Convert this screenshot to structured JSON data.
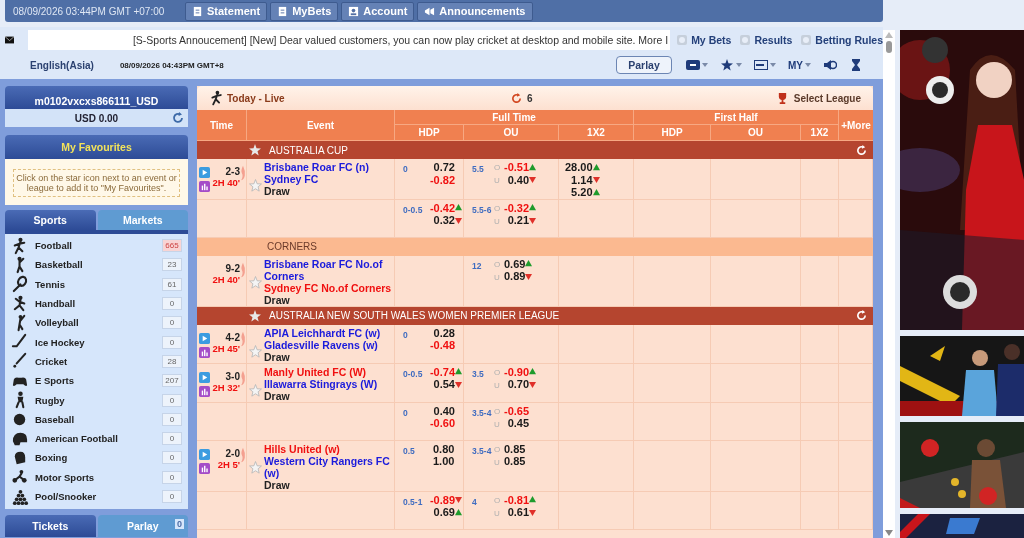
{
  "top_bar": {
    "datetime": "08/09/2026 03:44PM GMT +07:00",
    "buttons": [
      {
        "label": "Statement"
      },
      {
        "label": "MyBets"
      },
      {
        "label": "Account"
      },
      {
        "label": "Announcements"
      }
    ]
  },
  "announcement": "[S-Sports Annoucement] [New] Dear valued customers, you can now play cricket at desktop and mobile site. More I",
  "links": [
    "My Bets",
    "Results",
    "Betting Rules"
  ],
  "language": "English(Asia)",
  "local_time": "08/09/2026 04:43PM GMT+8",
  "parlay_button": "Parlay",
  "odds_format": "MY",
  "account": {
    "username": "m0102vxcxs866111_USD",
    "balance": "USD 0.00"
  },
  "favourites": {
    "title": "My Favourites",
    "hint": "Click on the star icon next to an event or league to add it to \"My Favourites\"."
  },
  "sidebar_tabs": [
    {
      "label": "Sports",
      "selected": true
    },
    {
      "label": "Markets",
      "selected": false
    }
  ],
  "sports": [
    {
      "name": "Football",
      "count": "665",
      "highlighted": true
    },
    {
      "name": "Basketball",
      "count": "23",
      "highlighted": false
    },
    {
      "name": "Tennis",
      "count": "61",
      "highlighted": false
    },
    {
      "name": "Handball",
      "count": "0",
      "highlighted": false
    },
    {
      "name": "Volleyball",
      "count": "0",
      "highlighted": false
    },
    {
      "name": "Ice Hockey",
      "count": "0",
      "highlighted": false
    },
    {
      "name": "Cricket",
      "count": "28",
      "highlighted": false
    },
    {
      "name": "E Sports",
      "count": "207",
      "highlighted": false
    },
    {
      "name": "Rugby",
      "count": "0",
      "highlighted": false
    },
    {
      "name": "Baseball",
      "count": "0",
      "highlighted": false
    },
    {
      "name": "American Football",
      "count": "0",
      "highlighted": false
    },
    {
      "name": "Boxing",
      "count": "0",
      "highlighted": false
    },
    {
      "name": "Motor Sports",
      "count": "0",
      "highlighted": false
    },
    {
      "name": "Pool/Snooker",
      "count": "0",
      "highlighted": false
    }
  ],
  "bottom_tabs": [
    {
      "label": "Tickets",
      "selected": true
    },
    {
      "label": "Parlay",
      "selected": false,
      "badge": "0"
    }
  ],
  "market": {
    "title": "Today - Live",
    "refresh_count": "6",
    "select_league": "Select League",
    "columns": {
      "time": "Time",
      "event": "Event",
      "full_time": "Full Time",
      "first_half": "First Half",
      "more": "+More",
      "sub": [
        "HDP",
        "OU",
        "1X2",
        "HDP",
        "OU",
        "1X2"
      ]
    },
    "sections": [
      {
        "kind": "league",
        "name": "AUSTRALIA CUP",
        "matches": [
          {
            "score": "2-3",
            "clock": "2H 40'",
            "live": true,
            "home": {
              "name": "Brisbane Roar FC (n)",
              "favourite": false
            },
            "away": {
              "name": "Sydney FC",
              "favourite": false
            },
            "draw": "Draw",
            "lines": [
              {
                "hdp": {
                  "line": "0",
                  "home": {
                    "odds": "0.72",
                    "negative": false
                  },
                  "away": {
                    "odds": "-0.82",
                    "negative": true
                  }
                },
                "ou": {
                  "line": "5.5",
                  "over_label": "O",
                  "under_label": "U",
                  "over": {
                    "odds": "-0.51",
                    "negative": true,
                    "rising": true
                  },
                  "under": {
                    "odds": "0.40",
                    "negative": false,
                    "rising": false
                  }
                },
                "x12": [
                  {
                    "odds": "28.00",
                    "negative": false,
                    "rising": true
                  },
                  {
                    "odds": "1.14",
                    "negative": false,
                    "rising": false
                  },
                  {
                    "odds": "5.20",
                    "negative": false,
                    "rising": true
                  }
                ]
              },
              {
                "hdp": {
                  "line": "0-0.5",
                  "home": {
                    "odds": "-0.42",
                    "negative": true,
                    "rising": true
                  },
                  "away": {
                    "odds": "0.32",
                    "negative": false,
                    "rising": false
                  }
                },
                "ou": {
                  "line": "5.5-6",
                  "over_label": "O",
                  "under_label": "U",
                  "over": {
                    "odds": "-0.32",
                    "negative": true,
                    "rising": true
                  },
                  "under": {
                    "odds": "0.21",
                    "negative": false,
                    "rising": false
                  }
                }
              }
            ]
          }
        ]
      },
      {
        "kind": "market",
        "name": "CORNERS",
        "matches": [
          {
            "score": "9-2",
            "clock": "2H 40'",
            "live": false,
            "home": {
              "name": "Brisbane Roar FC No.of Corners",
              "favourite": false
            },
            "away": {
              "name": "Sydney FC No.of Corners",
              "favourite": true
            },
            "draw": "Draw",
            "lines": [
              {
                "ou": {
                  "line": "12",
                  "over_label": "O",
                  "under_label": "U",
                  "over": {
                    "odds": "0.69",
                    "negative": false,
                    "rising": true
                  },
                  "under": {
                    "odds": "0.89",
                    "negative": false,
                    "rising": false
                  }
                }
              }
            ]
          }
        ]
      },
      {
        "kind": "league",
        "name": "AUSTRALIA NEW SOUTH WALES WOMEN PREMIER LEAGUE",
        "matches": [
          {
            "score": "4-2",
            "clock": "2H 45'",
            "live": true,
            "home": {
              "name": "APIA Leichhardt FC (w)",
              "favourite": false
            },
            "away": {
              "name": "Gladesville Ravens (w)",
              "favourite": false
            },
            "draw": "Draw",
            "lines": [
              {
                "hdp": {
                  "line": "0",
                  "home": {
                    "odds": "0.28",
                    "negative": false
                  },
                  "away": {
                    "odds": "-0.48",
                    "negative": true
                  }
                }
              }
            ]
          },
          {
            "score": "3-0",
            "clock": "2H 32'",
            "live": true,
            "home": {
              "name": "Manly United FC (W)",
              "favourite": true
            },
            "away": {
              "name": "Illawarra Stingrays (W)",
              "favourite": false
            },
            "draw": "Draw",
            "lines": [
              {
                "hdp": {
                  "line": "0-0.5",
                  "home": {
                    "odds": "-0.74",
                    "negative": true,
                    "rising": true
                  },
                  "away": {
                    "odds": "0.54",
                    "negative": false,
                    "rising": false
                  }
                },
                "ou": {
                  "line": "3.5",
                  "over_label": "O",
                  "under_label": "U",
                  "over": {
                    "odds": "-0.90",
                    "negative": true,
                    "rising": true
                  },
                  "under": {
                    "odds": "0.70",
                    "negative": false,
                    "rising": false
                  }
                }
              },
              {
                "hdp": {
                  "line": "0",
                  "home": {
                    "odds": "0.40",
                    "negative": false
                  },
                  "away": {
                    "odds": "-0.60",
                    "negative": true
                  }
                },
                "ou": {
                  "line": "3.5-4",
                  "over_label": "O",
                  "under_label": "U",
                  "over": {
                    "odds": "-0.65",
                    "negative": true
                  },
                  "under": {
                    "odds": "0.45",
                    "negative": false
                  }
                }
              }
            ]
          },
          {
            "score": "2-0",
            "clock": "2H 5'",
            "live": true,
            "home": {
              "name": "Hills United (w)",
              "favourite": true
            },
            "away": {
              "name": "Western City Rangers FC (w)",
              "favourite": false
            },
            "draw": "Draw",
            "lines": [
              {
                "hdp": {
                  "line": "0.5",
                  "home": {
                    "odds": "0.80",
                    "negative": false
                  },
                  "away": {
                    "odds": "1.00",
                    "negative": false
                  }
                },
                "ou": {
                  "line": "3.5-4",
                  "over_label": "O",
                  "under_label": "U",
                  "over": {
                    "odds": "0.85",
                    "negative": false
                  },
                  "under": {
                    "odds": "0.85",
                    "negative": false
                  }
                }
              },
              {
                "hdp": {
                  "line": "0.5-1",
                  "home": {
                    "odds": "-0.89",
                    "negative": true,
                    "rising": false
                  },
                  "away": {
                    "odds": "0.69",
                    "negative": false,
                    "rising": true
                  }
                },
                "ou": {
                  "line": "4",
                  "over_label": "O",
                  "under_label": "U",
                  "over": {
                    "odds": "-0.81",
                    "negative": true,
                    "rising": true
                  },
                  "under": {
                    "odds": "0.61",
                    "negative": false,
                    "rising": false
                  }
                }
              }
            ]
          }
        ]
      }
    ]
  }
}
